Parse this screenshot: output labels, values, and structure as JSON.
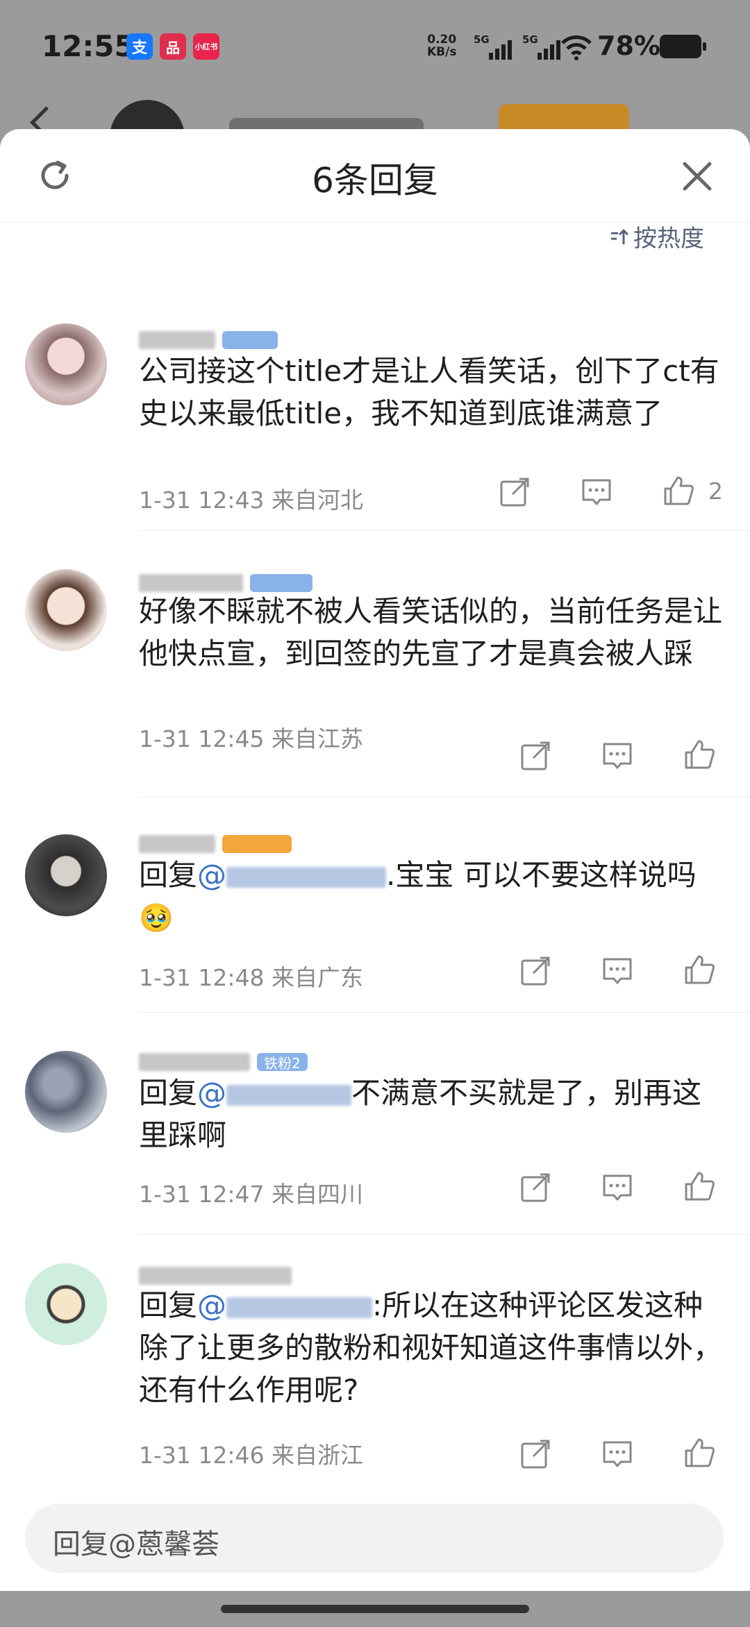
{
  "status_bar": {
    "time": "12:55",
    "apps": [
      {
        "label": "支",
        "color": "#1677ff"
      },
      {
        "label": "品",
        "color": "#e02e4c"
      },
      {
        "label": "小红书",
        "color": "#e8244a"
      }
    ],
    "net_speed_value": "0.20",
    "net_speed_unit": "KB/s",
    "signal1": "5G",
    "signal2": "5G",
    "battery": "78%"
  },
  "sheet": {
    "title": "6条回复",
    "sort_label": "按热度"
  },
  "comments": [
    {
      "text": "公司接这个title才是让人看笑话，创下了ct有史以来最低title，我不知道到底谁满意了",
      "time": "1-31 12:43",
      "location": "来自河北",
      "likes": "2"
    },
    {
      "text": "好像不睬就不被人看笑话似的，当前任务是让他快点宣，到回签的先宣了才是真会被人踩",
      "time": "1-31 12:45",
      "location": "来自江苏",
      "likes": ""
    },
    {
      "reply_prefix": "回复",
      "mention": "@",
      "text": ".宝宝 可以不要这样说吗",
      "emoji": "🥹",
      "time": "1-31 12:48",
      "location": "来自广东",
      "likes": ""
    },
    {
      "reply_prefix": "回复",
      "mention": "@",
      "text": "不满意不买就是了，别再这里踩啊",
      "badge": "铁粉2",
      "time": "1-31 12:47",
      "location": "来自四川",
      "likes": ""
    },
    {
      "reply_prefix": "回复",
      "mention": "@",
      "text": ":所以在这种评论区发这种除了让更多的散粉和视奸知道这件事情以外，还有什么作用呢?",
      "time": "1-31 12:46",
      "location": "来自浙江",
      "likes": ""
    }
  ],
  "reply_input": {
    "placeholder": "回复@蒽馨荟"
  }
}
